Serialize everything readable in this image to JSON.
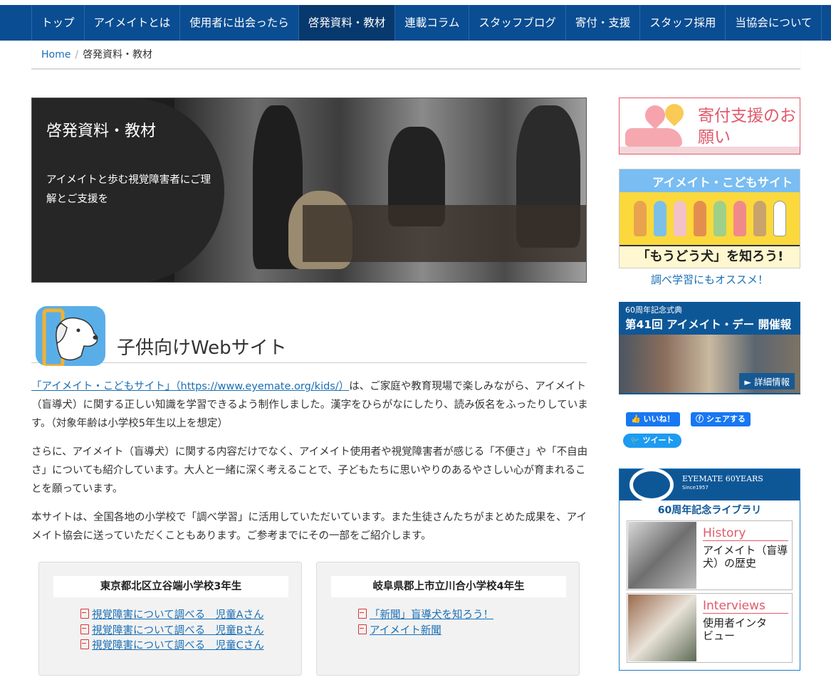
{
  "nav": [
    "トップ",
    "アイメイトとは",
    "使用者に出会ったら",
    "啓発資料・教材",
    "連載コラム",
    "スタッフブログ",
    "寄付・支援",
    "スタッフ採用",
    "当協会について"
  ],
  "breadcrumb": {
    "home": "Home",
    "sep": "/",
    "current": "啓発資料・教材"
  },
  "hero": {
    "title": "啓発資料・教材",
    "sub": "アイメイトと歩む視覚障害者にご理解とご支援を"
  },
  "section": {
    "title": "子供向けWebサイト"
  },
  "paragraphs": {
    "p1_link": "「アイメイト・こどもサイト」（https://www.eyemate.org/kids/）",
    "p1_text": "は、ご家庭や教育現場で楽しみながら、アイメイト（盲導犬）に関する正しい知識を学習できるよう制作しました。漢字をひらがなにしたり、読み仮名をふったりしています。（対象年齢は小学校5年生以上を想定）",
    "p2": "さらに、アイメイト（盲導犬）に関する内容だけでなく、アイメイト使用者や視覚障害者が感じる「不便さ」や「不自由さ」についても紹介しています。大人と一緒に深く考えることで、子どもたちに思いやりのあるやさしい心が育まれることを願っています。",
    "p3": "本サイトは、全国各地の小学校で「調べ学習」に活用していただいています。また生徒さんたちがまとめた成果を、アイメイト協会に送っていただくこともあります。ご参考までにその一部をご紹介します。"
  },
  "boxes": [
    {
      "title": "東京都北区立谷端小学校3年生",
      "links": [
        "視覚障害について調べる　児童Aさん",
        "視覚障害について調べる　児童Bさん",
        "視覚障害について調べる　児童Cさん"
      ]
    },
    {
      "title": "岐阜県郡上市立川合小学校4年生",
      "links": [
        "「新聞」盲導犬を知ろう！",
        "アイメイト新聞"
      ]
    }
  ],
  "sidebar": {
    "donate": "寄付支援のお願い",
    "kids_title": "アイメイト・こどもサイト",
    "kids_banner": "「もうどう犬」を知ろう!",
    "kids_caption": "調べ学習にもオススメ！",
    "anniv_small": "60周年記念式典",
    "anniv_title": "第41回 アイメイト・デー 開催報告",
    "anniv_more": "► 詳細情報",
    "like": "いいね！",
    "share": "シェアする",
    "tweet": "ツイート",
    "lib_brand": "EYEMATE 60YEARS",
    "lib_since": "Since1957",
    "lib_title": "60周年記念ライブラリ",
    "card1_k": "History",
    "card1_d": "アイメイト（盲導犬）の歴史",
    "card2_k": "Interviews",
    "card2_d": "使用者インタビュー"
  },
  "colors": {
    "nav": "#0a4d92",
    "link": "#1a6fb5",
    "pink": "#e05a6b"
  }
}
